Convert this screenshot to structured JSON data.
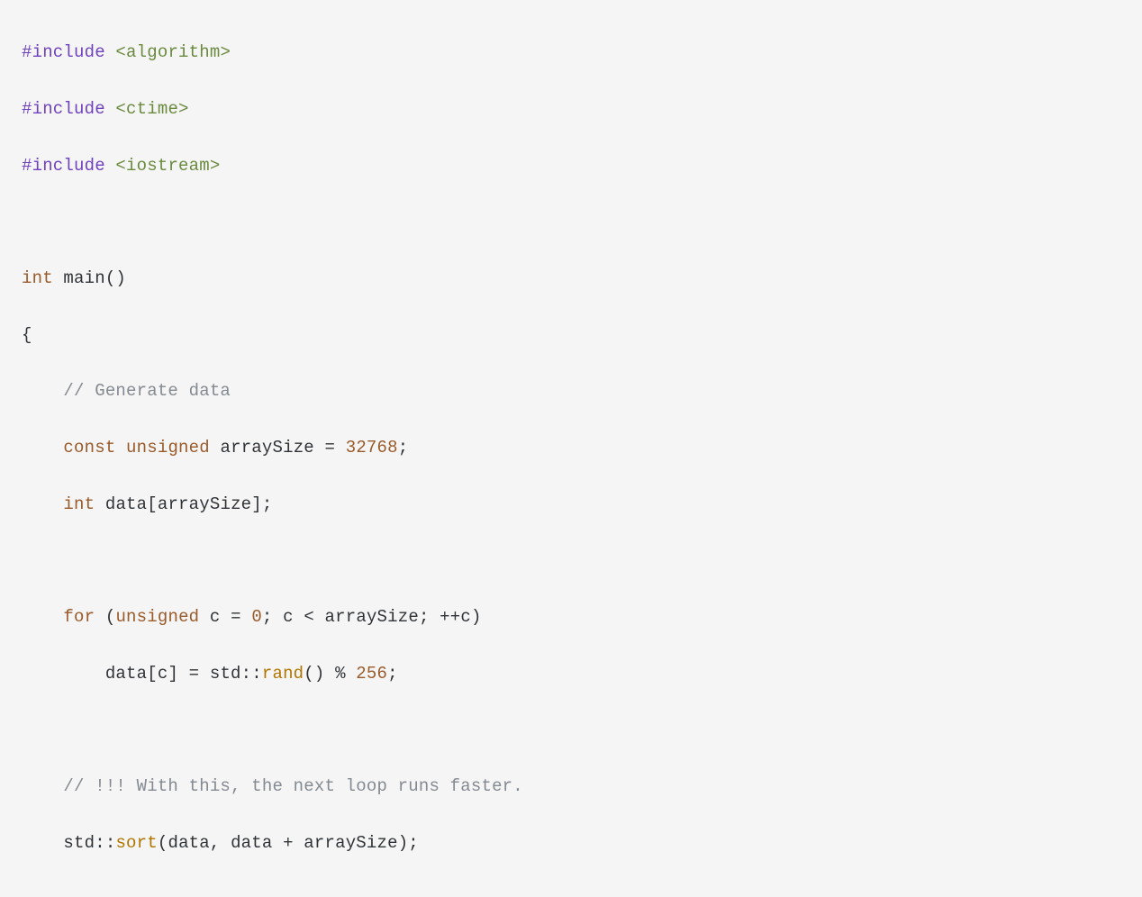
{
  "code": {
    "include1_directive": "#include",
    "include1_header": " <algorithm>",
    "include2_directive": "#include",
    "include2_header": " <ctime>",
    "include3_directive": "#include",
    "include3_header": " <iostream>",
    "main_type": "int",
    "main_name": " main",
    "main_parens": "()",
    "open_brace": "{",
    "comment_generate": "    // Generate data",
    "indent1": "    ",
    "const_kw": "const",
    "sp1": " ",
    "unsigned_kw": "unsigned",
    "sp2": " ",
    "arraySize_id": "arraySize = ",
    "arraySize_val": "32768",
    "semi1": ";",
    "indent2": "    ",
    "int_kw": "int",
    "sp3": " ",
    "data_decl": "data[arraySize];",
    "indent3": "    ",
    "for_kw": "for",
    "for_open": " (",
    "unsigned_kw2": "unsigned",
    "sp4": " ",
    "c_init": "c = ",
    "zero": "0",
    "for_cond": "; c < arraySize; ++c)",
    "indent4": "        ",
    "body1": "data[c] = std::",
    "rand_call": "rand",
    "body2": "() % ",
    "val256": "256",
    "semi2": ";",
    "comment_faster": "    // !!! With this, the next loop runs faster.",
    "indent5": "    ",
    "std_ns": "std::",
    "sort_call": "sort",
    "sort_args": "(data, data + arraySize);"
  }
}
